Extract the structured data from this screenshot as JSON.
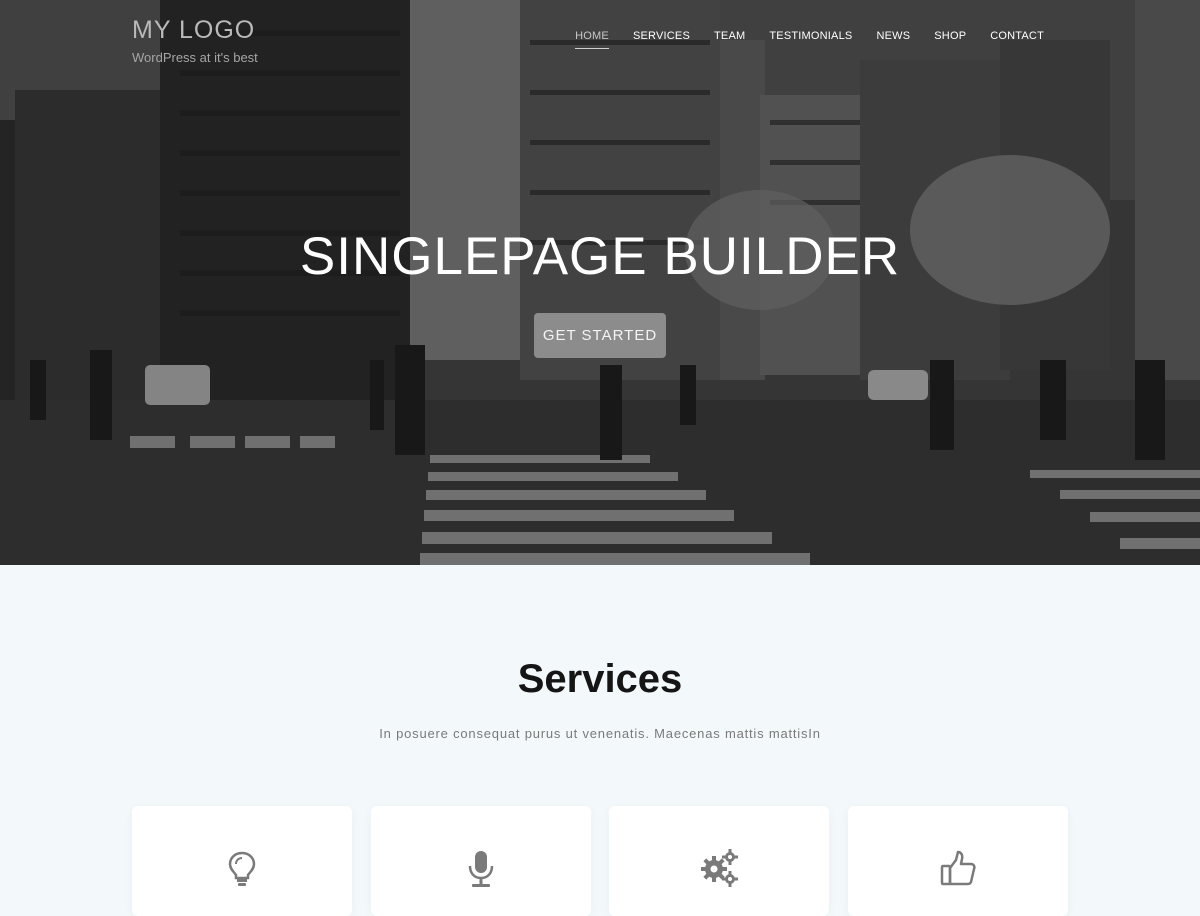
{
  "header": {
    "logo_title": "MY LOGO",
    "logo_tagline": "WordPress at it's best"
  },
  "nav": {
    "items": [
      {
        "label": "HOME",
        "active": true
      },
      {
        "label": "SERVICES",
        "active": false
      },
      {
        "label": "TEAM",
        "active": false
      },
      {
        "label": "TESTIMONIALS",
        "active": false
      },
      {
        "label": "NEWS",
        "active": false
      },
      {
        "label": "SHOP",
        "active": false
      },
      {
        "label": "CONTACT",
        "active": false
      }
    ]
  },
  "hero": {
    "title": "SINGLEPAGE BUILDER",
    "button_label": "GET STARTED"
  },
  "services": {
    "title": "Services",
    "subtitle": "In posuere consequat purus ut venenatis. Maecenas mattis mattisIn",
    "cards": [
      {
        "icon": "lightbulb-icon"
      },
      {
        "icon": "microphone-icon"
      },
      {
        "icon": "gears-icon"
      },
      {
        "icon": "thumbs-up-icon"
      }
    ]
  },
  "colors": {
    "icon_gray": "#7a7a7a",
    "button_bg": "#8c8c8c",
    "section_bg": "#f3f8fb"
  }
}
